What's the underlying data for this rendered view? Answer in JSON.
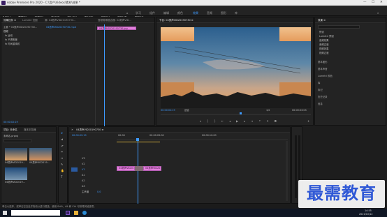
{
  "window": {
    "title": "Adobe Premiere Pro 2020 - C:\\用户\\Videos\\素材\\效果 *",
    "min": "—",
    "max": "☐",
    "close": "✕"
  },
  "menu": [
    "文件(F)",
    "编辑(E)",
    "剪辑(C)",
    "序列(S)",
    "标记(M)",
    "图形(G)",
    "视图(V)",
    "窗口(W)",
    "帮助(H)"
  ],
  "workspaces": [
    "学习",
    "组件",
    "编辑",
    "颜色",
    "效果",
    "音频",
    "图形",
    "库"
  ],
  "active_workspace": "效果",
  "effect_controls": {
    "tabs": [
      "效果控件 ≡",
      "Lumetri 范围",
      "源: 04男声VID20190730...",
      "音频剪辑混合器: 04男声VID..."
    ],
    "source_label": "主要 * 04男声VID20190730...",
    "clip_label": "04男声VID20190730.mp4",
    "section_video": "视频",
    "props": [
      "fx 运动",
      "fx 不透明度",
      "fx 时间重映射"
    ],
    "clip_bar": "04男声VID20190730.jpg",
    "timecode": "00:00:02:19"
  },
  "program": {
    "tab": "节目: 04男声VID20190730 ≡",
    "timecode": "00:00:02:19",
    "fit": "适合",
    "scale": "1/2",
    "duration": "00:00:03:03"
  },
  "effects_panel": {
    "title": "效果 ≡",
    "items": [
      "预设",
      "Lumetri 预设",
      "音频效果",
      "音频过渡",
      "视频效果",
      "视频过渡"
    ],
    "sections": [
      "基本图形",
      "基本声音",
      "Lumetri 颜色",
      "库",
      "标记",
      "历史记录",
      "信息"
    ]
  },
  "project": {
    "tabs": [
      "项目: 未命名",
      "媒体浏览器"
    ],
    "file": "未命名.prproj",
    "items": [
      {
        "name": "04男声VID2019...",
        "dur": "5:00"
      },
      {
        "name": "04男声VID2019...",
        "dur": "5:00"
      },
      {
        "name": "04男声VID2019...",
        "dur": "5:00"
      }
    ]
  },
  "timeline": {
    "tab": "04男声VID20190730 ≡",
    "timecode": "00:00:02:19",
    "ruler": [
      "00:00",
      "00:00:05:00",
      "00:00:10:00"
    ],
    "tracks_v": [
      "V3",
      "V2",
      "V1"
    ],
    "tracks_a": [
      "A1",
      "A2",
      "A3"
    ],
    "master": "主声道",
    "master_val": "0.0",
    "clip_a": "04男声VID2019...",
    "clip_b": "04男声VID2019..."
  },
  "status": "单击以选择，或单击空白处并拖动以进行框选。使用 Shift、Alt 和 Ctrl 可获得其他选项。",
  "taskbar": {
    "time": "14:55",
    "date": "2021/10/12"
  },
  "watermark": "最需教育",
  "colors": {
    "accent": "#3e9bff",
    "clip": "#e37fdc",
    "watermark": "#2f58d6"
  }
}
